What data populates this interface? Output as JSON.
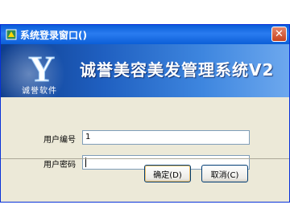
{
  "window": {
    "title": "系统登录窗口()",
    "close_glyph": "✕"
  },
  "banner": {
    "logo_letter": "Y",
    "company": "诚誉软件",
    "system_title": "诚誉美容美发管理系统V2"
  },
  "form": {
    "user_id": {
      "label": "用户编号",
      "value": "1"
    },
    "password": {
      "label": "用户密码",
      "value": ""
    }
  },
  "buttons": {
    "ok": "确定(D)",
    "cancel": "取消(C)"
  },
  "colors": {
    "titlebar": "#0A5DD8",
    "banner": "#1F5FC0",
    "dialog_bg": "#ECE9D8",
    "close": "#C8421E"
  }
}
